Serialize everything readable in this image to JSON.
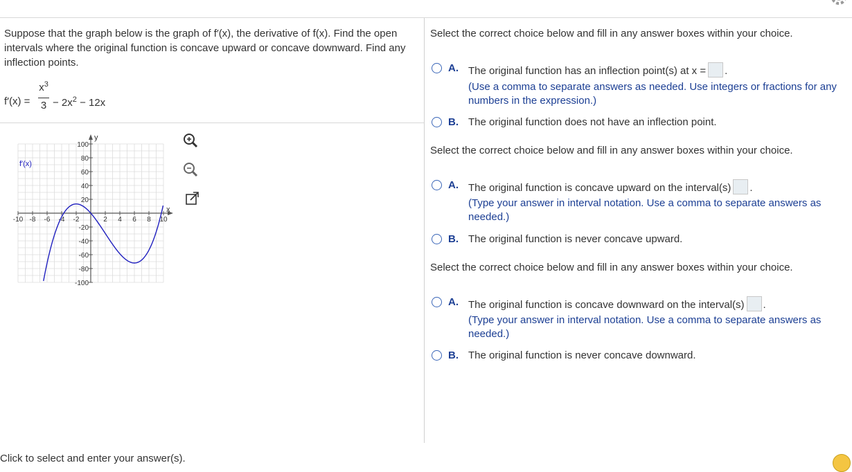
{
  "question": {
    "text": "Suppose that the graph below is the graph of f′(x), the derivative of f(x). Find the open intervals where the original function is concave upward or concave downward. Find any inflection points."
  },
  "formula": {
    "lhs": "f′(x) =",
    "numerator": "x",
    "numerator_exp": "3",
    "denominator": "3",
    "rest_a": "− 2x",
    "rest_exp": "2",
    "rest_b": " − 12x"
  },
  "graph": {
    "legend": "f′(x)",
    "x_label": "x",
    "y_label": "y",
    "x_ticks": [
      "-10",
      "-8",
      "-6",
      "-4",
      "-2",
      "2",
      "4",
      "6",
      "8",
      "10"
    ],
    "y_ticks": [
      "100",
      "80",
      "60",
      "40",
      "20",
      "-20",
      "-40",
      "-60",
      "-80",
      "-100"
    ],
    "curve_color": "#1f1fbf",
    "chart_data": {
      "type": "line",
      "function": "x^3/3 - 2x^2 - 12x",
      "xlim": [
        -10,
        10
      ],
      "ylim": [
        -100,
        100
      ],
      "grid": true
    }
  },
  "tools": {
    "zoom_in_icon": "zoom-in-icon",
    "zoom_out_icon": "zoom-out-icon",
    "popout_icon": "external-link-icon"
  },
  "sections": [
    {
      "instruction": "Select the correct choice below and fill in any answer boxes within your choice.",
      "option_a": {
        "letter": "A.",
        "text": "The original function has an inflection point(s) at x =",
        "hint": "(Use a comma to separate answers as needed. Use integers or fractions for any numbers in the expression.)"
      },
      "option_b": {
        "letter": "B.",
        "text": "The original function does not have an inflection point."
      }
    },
    {
      "instruction": "Select the correct choice below and fill in any answer boxes within your choice.",
      "option_a": {
        "letter": "A.",
        "text": "The original function is concave upward on the interval(s)",
        "hint": "(Type your answer in interval notation. Use a comma to separate answers as needed.)"
      },
      "option_b": {
        "letter": "B.",
        "text": "The original function is never concave upward."
      }
    },
    {
      "instruction": "Select the correct choice below and fill in any answer boxes within your choice.",
      "option_a": {
        "letter": "A.",
        "text": "The original function is concave downward on the interval(s)",
        "hint": "(Type your answer in interval notation. Use a comma to separate answers as needed.)"
      },
      "option_b": {
        "letter": "B.",
        "text": "The original function is never concave downward."
      }
    }
  ],
  "footer": {
    "text": "Click to select and enter your answer(s)."
  },
  "colors": {
    "accent": "#1c3f94",
    "radio": "#3a66b8",
    "answer_box": "#e8eef2"
  }
}
